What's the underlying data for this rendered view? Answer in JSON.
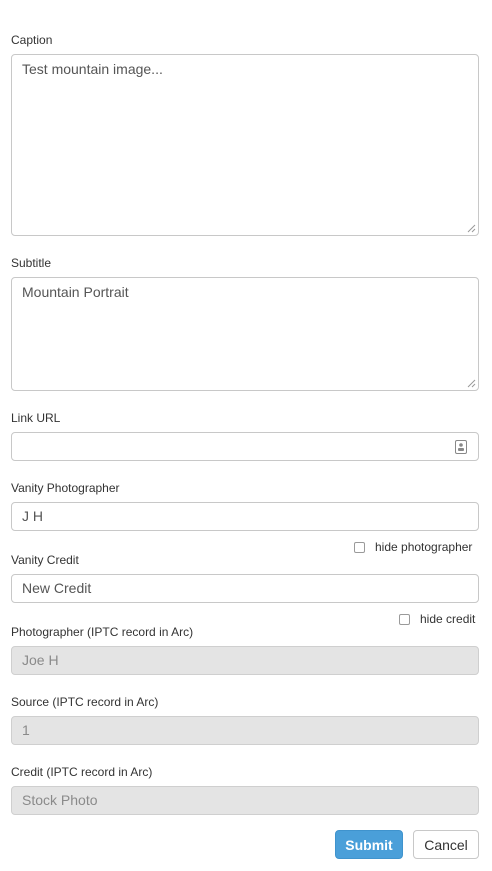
{
  "caption": {
    "label": "Caption",
    "value": "Test mountain image..."
  },
  "subtitle": {
    "label": "Subtitle",
    "value": "Mountain Portrait"
  },
  "link_url": {
    "label": "Link URL",
    "value": ""
  },
  "vanity_photographer": {
    "label": "Vanity Photographer",
    "value": "J H",
    "hide_label": "hide photographer",
    "hide_checked": false
  },
  "vanity_credit": {
    "label": "Vanity Credit",
    "value": "New Credit",
    "hide_label": "hide credit",
    "hide_checked": false
  },
  "photographer_iptc": {
    "label": "Photographer (IPTC record in Arc)",
    "value": "Joe H"
  },
  "source_iptc": {
    "label": "Source (IPTC record in Arc)",
    "value": "1"
  },
  "credit_iptc": {
    "label": "Credit (IPTC record in Arc)",
    "value": "Stock Photo"
  },
  "actions": {
    "submit_label": "Submit",
    "cancel_label": "Cancel"
  }
}
